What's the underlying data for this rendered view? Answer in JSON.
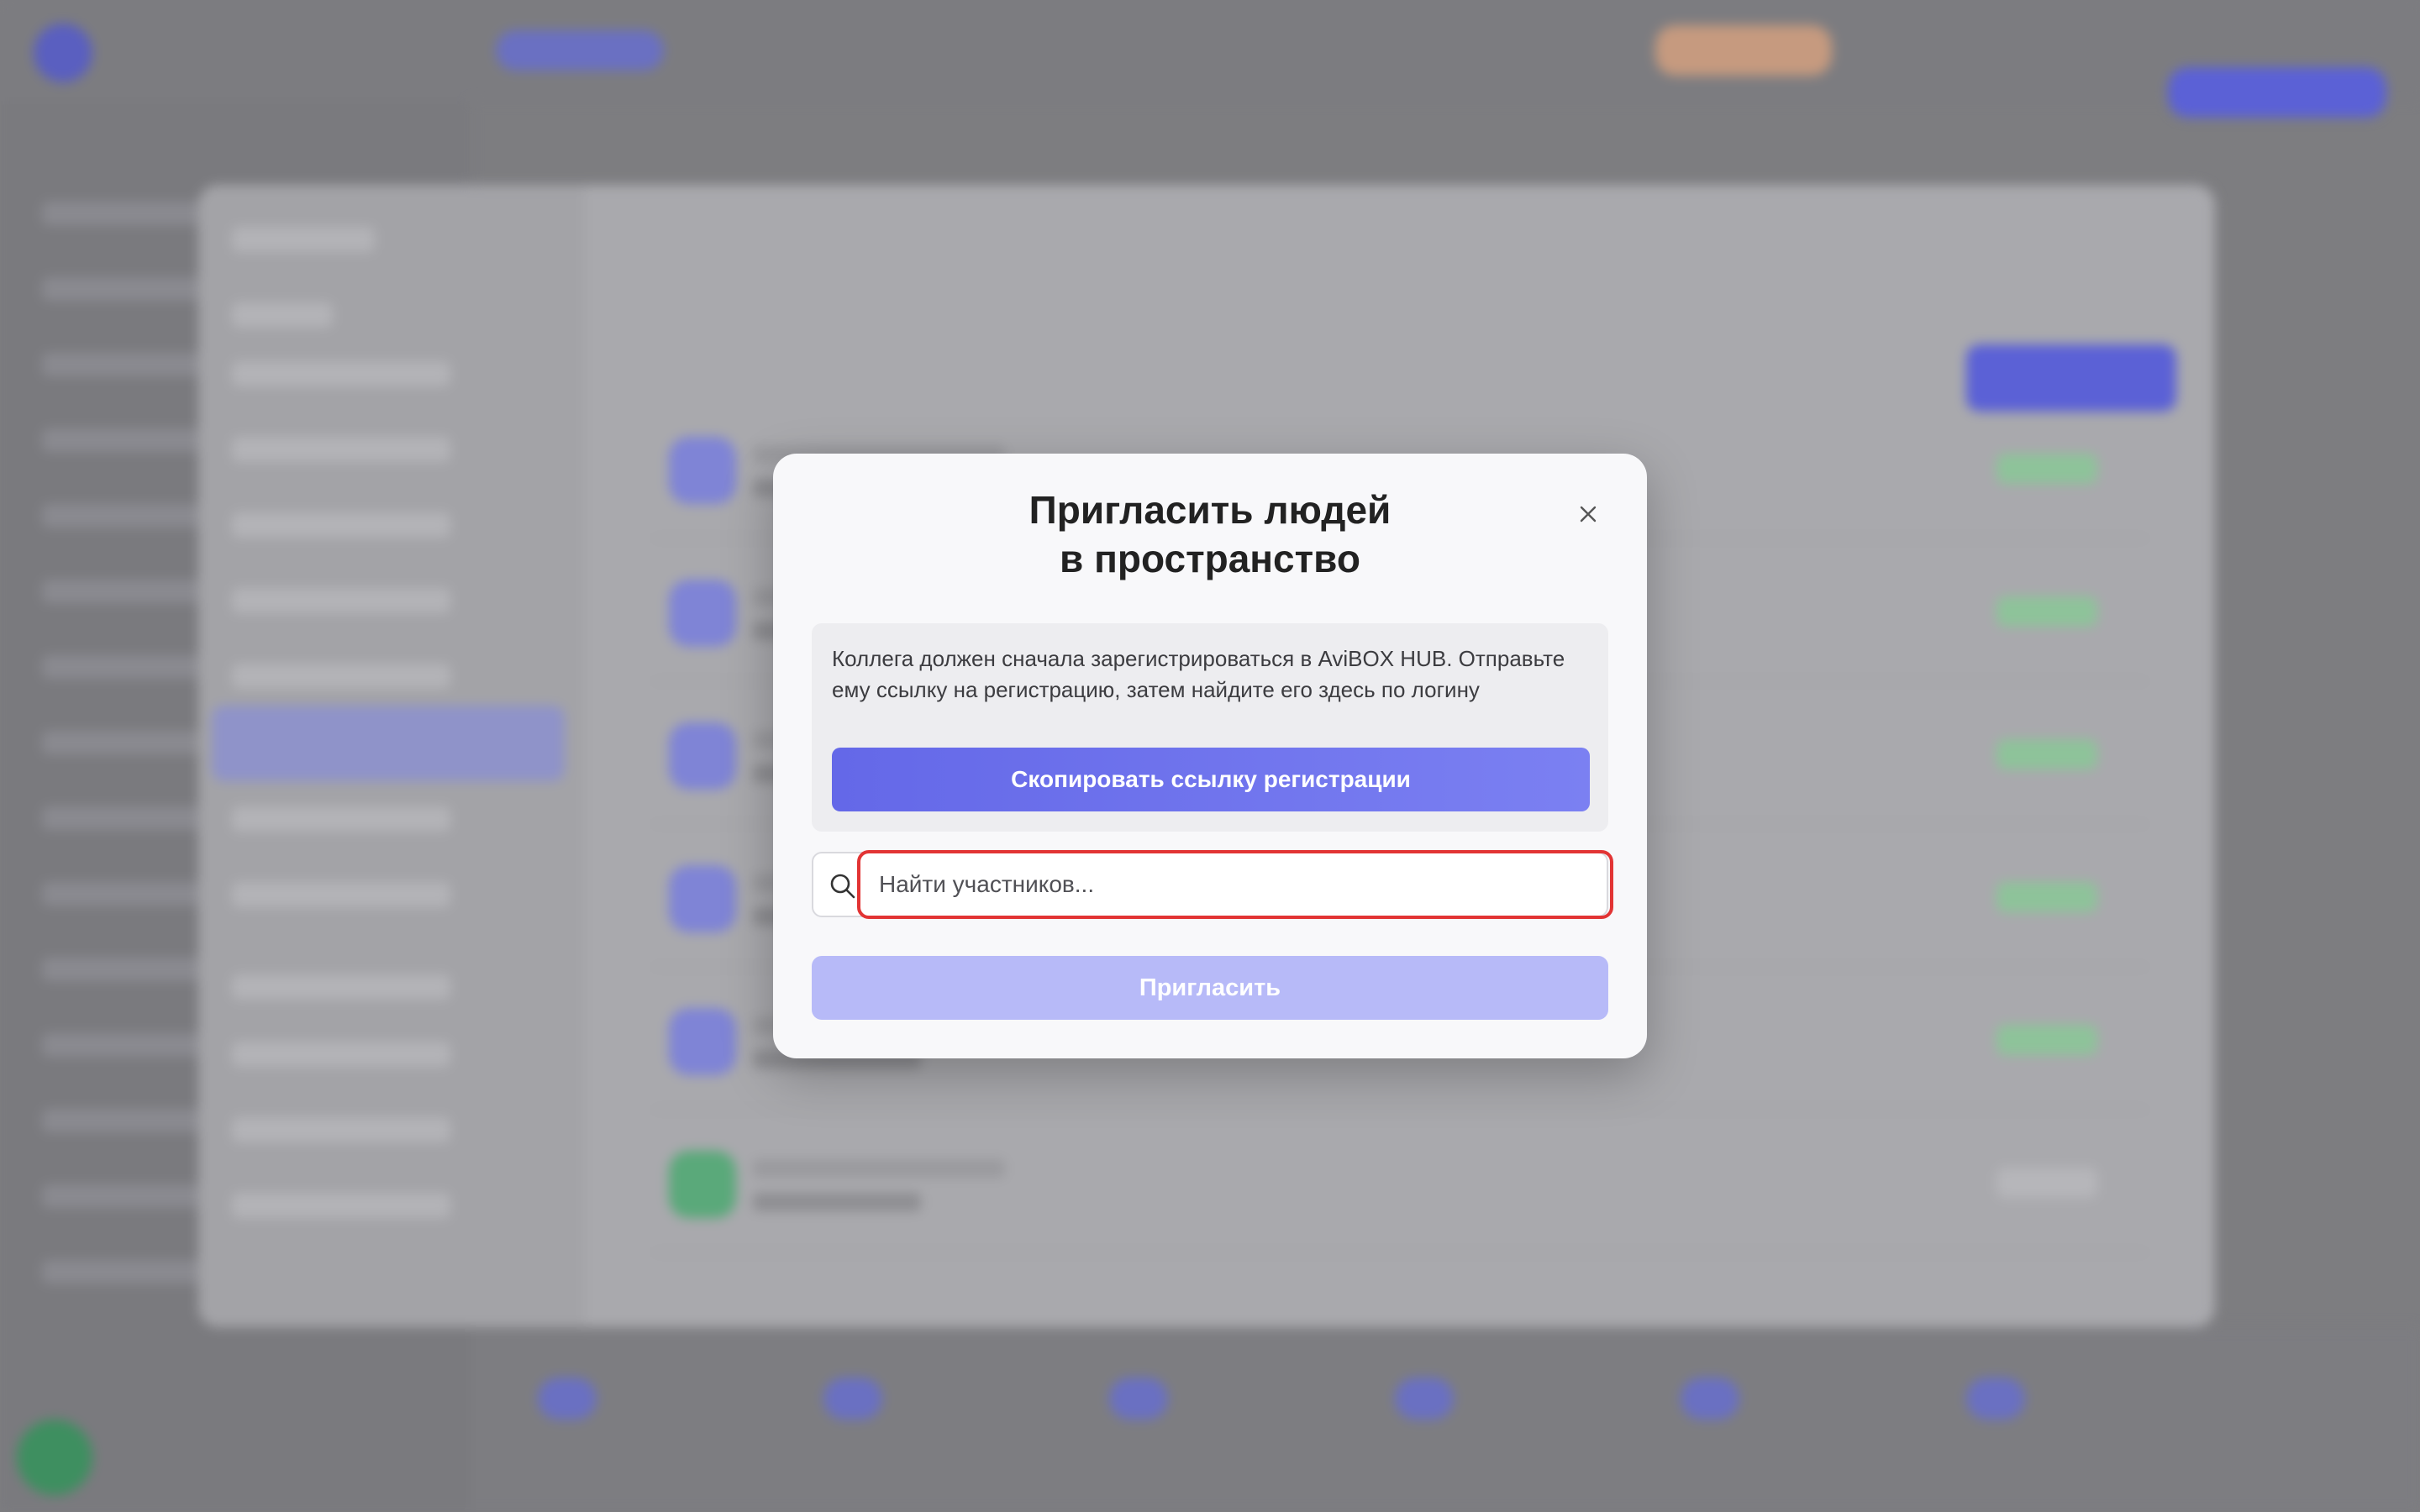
{
  "modal": {
    "title_line1": "Пригласить людей",
    "title_line2": "в пространство",
    "info_text": "Коллега должен сначала зарегистрироваться в AviBOX HUB. Отправьте ему ссылку на регистрацию, затем найдите его здесь по логину",
    "copy_link_label": "Скопировать ссылку регистрации",
    "search_placeholder": "Найти участников...",
    "search_value": "",
    "invite_label": "Пригласить",
    "close_icon": "close-icon",
    "search_icon": "search-icon"
  },
  "colors": {
    "primary": "#6468e8",
    "primary_disabled": "#b7baf8",
    "highlight": "#e23434"
  }
}
